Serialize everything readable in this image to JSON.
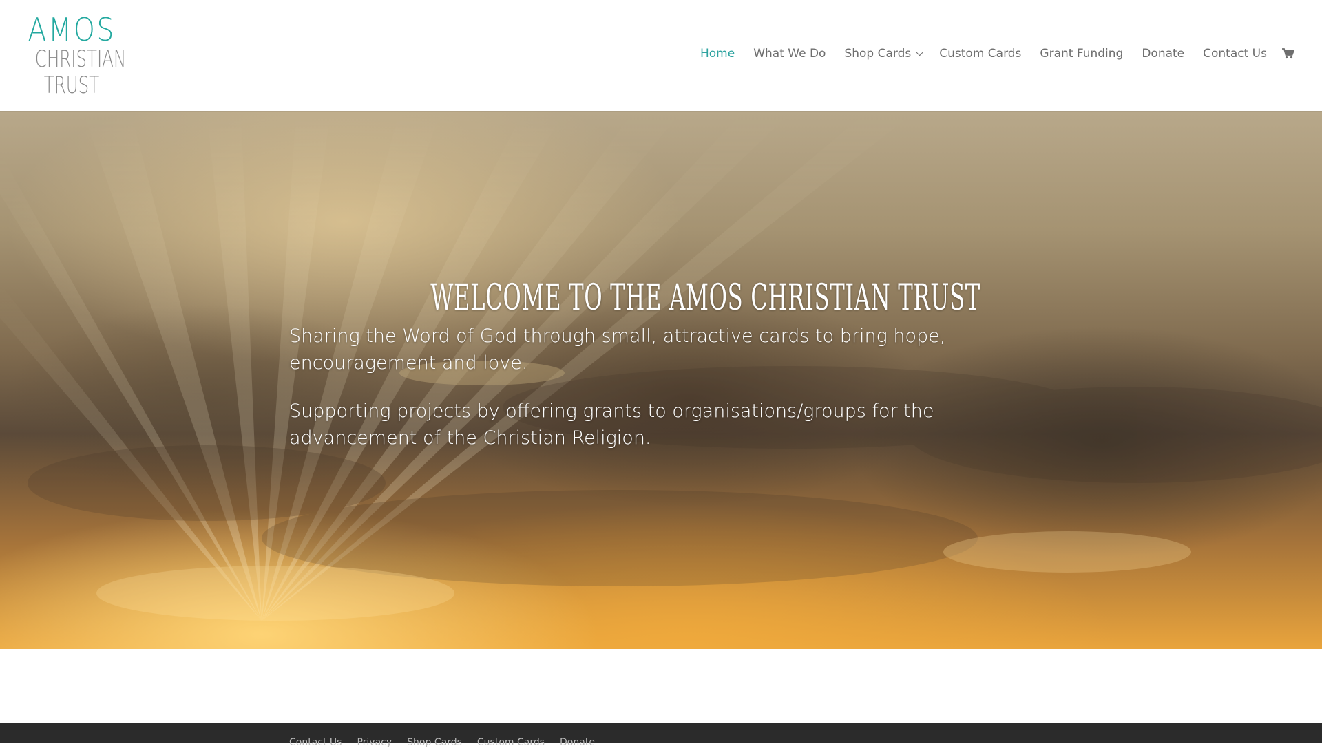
{
  "logo": {
    "line1": "AMOS",
    "line2": "CHRISTIAN",
    "line3": "TRUST"
  },
  "nav": {
    "items": [
      {
        "label": "Home",
        "active": true
      },
      {
        "label": "What We Do"
      },
      {
        "label": "Shop Cards",
        "has_dropdown": true
      },
      {
        "label": "Custom Cards"
      },
      {
        "label": "Grant Funding"
      },
      {
        "label": "Donate"
      },
      {
        "label": "Contact Us"
      }
    ],
    "cart_icon": "shopping-cart-icon",
    "dropdown_icon": "chevron-down-icon"
  },
  "hero": {
    "title": "WELCOME TO THE AMOS CHRISTIAN TRUST",
    "paragraph1": "Sharing the Word of God through small, attractive cards to bring hope, encouragement and love.",
    "paragraph2": "Supporting projects by offering grants to organisations/groups for the advancement of the Christian Religion."
  },
  "footer": {
    "links": [
      "Contact Us",
      "Privacy",
      "Shop Cards",
      "Custom Cards",
      "Donate"
    ]
  },
  "colors": {
    "accent": "#2ea3a0",
    "nav_text": "#6e6e6e",
    "footer_bg": "#2b2b2b"
  }
}
